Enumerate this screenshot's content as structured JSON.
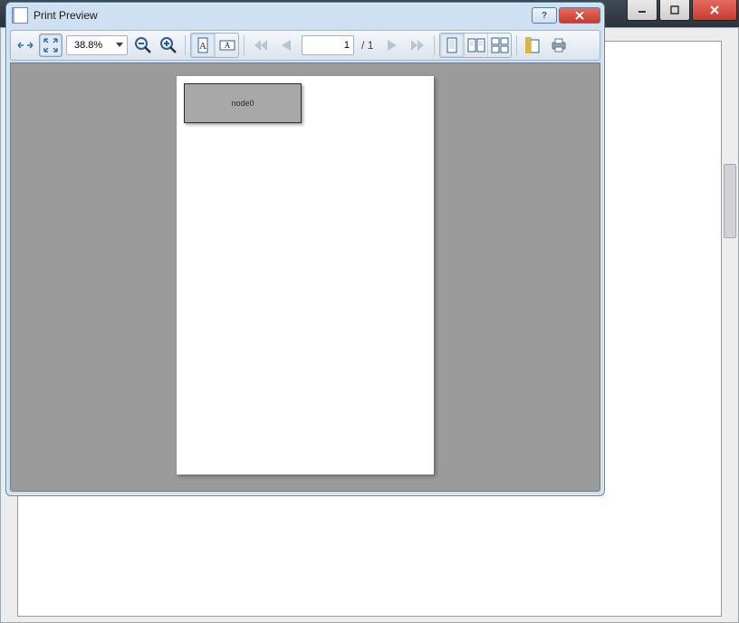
{
  "window": {
    "title": "Print Preview",
    "help_symbol": "?",
    "close_symbol": "×"
  },
  "toolbar": {
    "zoom_value": "38.8%",
    "current_page": "1",
    "page_sep": "/",
    "total_pages": "1"
  },
  "document": {
    "node_label": "node0"
  },
  "background": {
    "minimize": "–",
    "maximize": "□",
    "close": "×"
  }
}
